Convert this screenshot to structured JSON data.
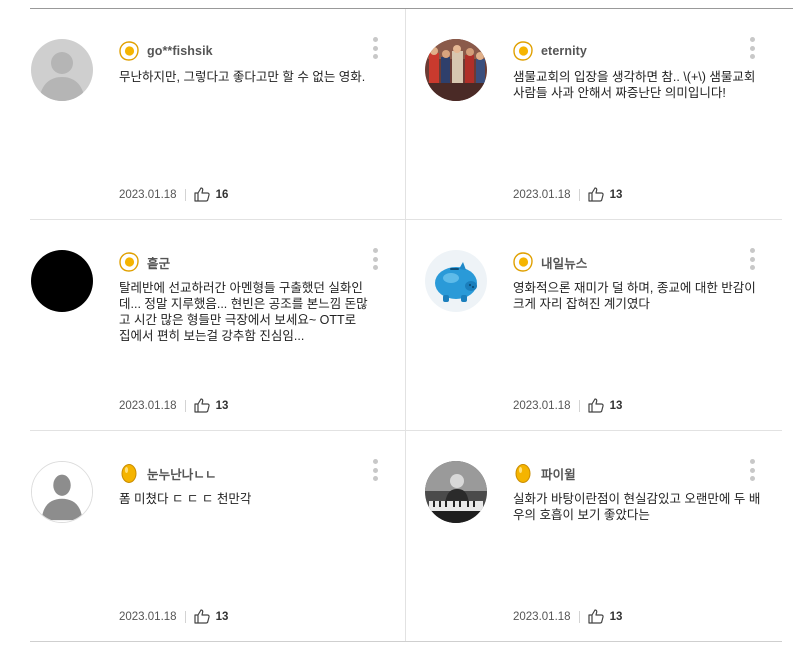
{
  "reviews": [
    {
      "nickname": "go**fishsik",
      "text": "무난하지만, 그렇다고 좋다고만 할 수 없는 영화.",
      "date": "2023.01.18",
      "likes": "16",
      "badge": "fried-egg",
      "avatar": "default-gray"
    },
    {
      "nickname": "eternity",
      "text": "샘물교회의 입장을 생각하면 참.. \\(+\\) 샘물교회사람들 사과 안해서 짜증난단 의미입니다!",
      "date": "2023.01.18",
      "likes": "13",
      "badge": "fried-egg",
      "avatar": "photo-crowd"
    },
    {
      "nickname": "흩군",
      "text": "탈레반에 선교하러간 아멘형들 구출했던 실화인데... 정말 지루했음... 현빈은 공조를 본느낌 돈많고 시간 많은 형들만 극장에서 보세요~ OTT로 집에서 편히 보는걸 강추함 진심임...",
      "date": "2023.01.18",
      "likes": "13",
      "badge": "fried-egg",
      "avatar": "black"
    },
    {
      "nickname": "내일뉴스",
      "text": "영화적으론 재미가 덜 하며, 종교에 대한 반감이 크게 자리 잡혀진 계기였다",
      "date": "2023.01.18",
      "likes": "13",
      "badge": "fried-egg",
      "avatar": "blue-piggy-bank"
    },
    {
      "nickname": "눈누난나ㄴㄴ",
      "text": "폼 미쳤다 ㄷ ㄷ ㄷ 천만각",
      "date": "2023.01.18",
      "likes": "13",
      "badge": "golden-egg",
      "avatar": "default-silhouette"
    },
    {
      "nickname": "파이윌",
      "text": "실화가 바탕이란점이 현실감있고 오랜만에 두 배우의 호흡이 보기 좋았다는",
      "date": "2023.01.18",
      "likes": "13",
      "badge": "golden-egg",
      "avatar": "photo-pianist"
    }
  ],
  "colors": {
    "egg_yellow": "#f5b400",
    "divider": "#e2e2e2",
    "text": "#222222"
  }
}
